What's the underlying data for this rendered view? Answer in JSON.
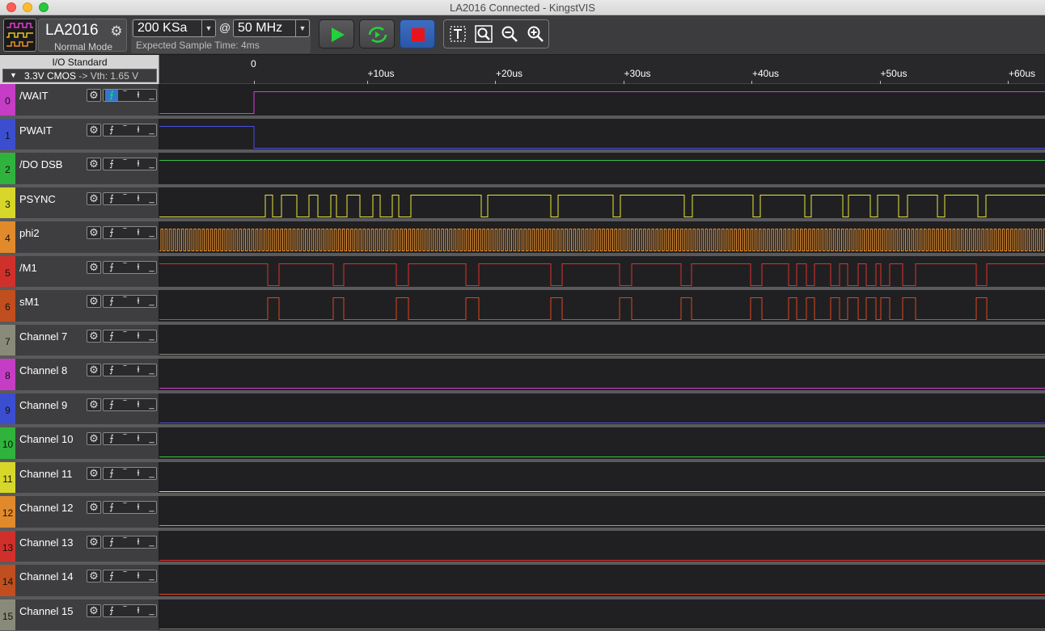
{
  "window": {
    "title": "LA2016 Connected - KingstVIS"
  },
  "device": {
    "name": "LA2016",
    "mode": "Normal Mode",
    "icon": "gear-icon"
  },
  "sampling": {
    "depth": "200 KSa",
    "at_symbol": "@",
    "rate": "50 MHz",
    "expected_time": "Expected Sample Time: 4ms"
  },
  "toolbar": {
    "run_icon": "play-icon",
    "loop_icon": "loop-run-icon",
    "stop_icon": "stop-icon",
    "tools": [
      "text-cursor-icon",
      "zoom-fit-icon",
      "zoom-out-icon",
      "zoom-in-icon"
    ]
  },
  "io_standard": {
    "title": "I/O Standard",
    "selected": "3.3V CMOS",
    "threshold": "-> Vth: 1.65 V"
  },
  "ruler": {
    "zero_label": "0",
    "ticks": [
      "+10us",
      "+20us",
      "+30us",
      "+40us",
      "+50us",
      "+60us"
    ]
  },
  "colors": {
    "idx": [
      "#c43dc4",
      "#3c4ed0",
      "#2fb33c",
      "#d7d72a",
      "#e08a2c",
      "#d0302c",
      "#c04e1e",
      "#8a8a7a",
      "#c43dc4",
      "#3c4ed0",
      "#2fb33c",
      "#d7d72a",
      "#e08a2c",
      "#d0302c",
      "#c04e1e",
      "#8a8a7a"
    ],
    "wave": [
      "#d63bd6",
      "#4a4ee0",
      "#34c24a",
      "#e6e63a",
      "#e8902c",
      "#e0302a",
      "#e0441c",
      "#8a8a7a",
      "#d63bd6",
      "#4a4ee0",
      "#34c24a",
      "#e6e63a",
      "#e8902c",
      "#e0302a",
      "#e0441c",
      "#8a8a7a"
    ]
  },
  "channels": [
    {
      "index": "0",
      "name": "/WAIT"
    },
    {
      "index": "1",
      "name": "PWAIT"
    },
    {
      "index": "2",
      "name": "/DO DSB"
    },
    {
      "index": "3",
      "name": "PSYNC"
    },
    {
      "index": "4",
      "name": "phi2"
    },
    {
      "index": "5",
      "name": "/M1"
    },
    {
      "index": "6",
      "name": "sM1"
    },
    {
      "index": "7",
      "name": "Channel 7"
    },
    {
      "index": "8",
      "name": "Channel 8"
    },
    {
      "index": "9",
      "name": "Channel 9"
    },
    {
      "index": "10",
      "name": "Channel 10"
    },
    {
      "index": "11",
      "name": "Channel 11"
    },
    {
      "index": "12",
      "name": "Channel 12"
    },
    {
      "index": "13",
      "name": "Channel 13"
    },
    {
      "index": "14",
      "name": "Channel 14"
    },
    {
      "index": "15",
      "name": "Channel 15"
    }
  ],
  "trigger_icons": [
    "rising-edge-icon",
    "high-level-icon",
    "falling-edge-icon",
    "low-level-icon"
  ]
}
